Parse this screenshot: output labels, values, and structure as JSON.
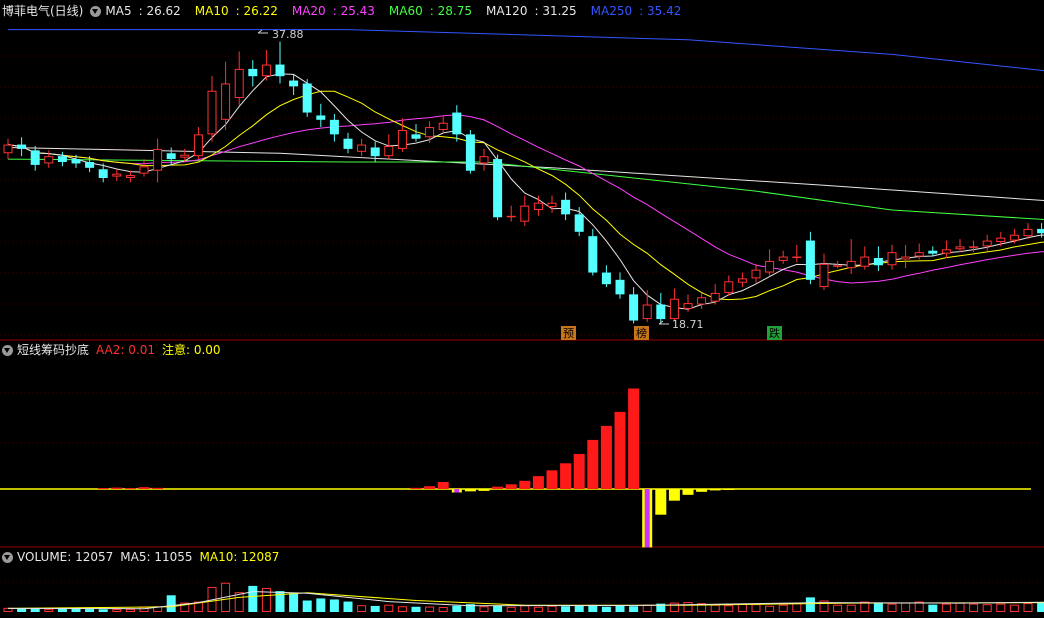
{
  "main_panel": {
    "title": "博菲电气(日线)",
    "ma_labels": [
      {
        "name": "MA5",
        "value": "26.62",
        "color": "#e6e6e6"
      },
      {
        "name": "MA10",
        "value": "26.22",
        "color": "#ffff00"
      },
      {
        "name": "MA20",
        "value": "25.43",
        "color": "#ff40ff"
      },
      {
        "name": "MA60",
        "value": "28.75",
        "color": "#40ff40"
      },
      {
        "name": "MA120",
        "value": "31.25",
        "color": "#e6e6e6"
      },
      {
        "name": "MA250",
        "value": "35.42",
        "color": "#3355ff"
      }
    ],
    "high_marker": "37.88",
    "low_marker": "18.71",
    "event_tags": [
      "预",
      "榜",
      "跌"
    ]
  },
  "indicator_panel": {
    "title": "短线筹码抄底",
    "aa2_label": "AA2: 0.01",
    "note_label": "注意: 0.00"
  },
  "volume_panel": {
    "title": "VOLUME: 12057",
    "ma5_label": "MA5: 11055",
    "ma10_label": "MA10: 12087"
  },
  "chart_data": {
    "type": "candlestick",
    "colors": {
      "up": "#ff3232",
      "down": "#54ffff",
      "background": "#000000",
      "ma5": "#e6e6e6",
      "ma10": "#ffff00",
      "ma20": "#ff40ff",
      "ma60": "#40ff40",
      "ma120": "#e6e6e6",
      "ma250": "#3355ff"
    },
    "price_range": [
      17.5,
      39.5
    ],
    "candles": [
      [
        30.2,
        30.8,
        31.2,
        29.8
      ],
      [
        30.8,
        30.5,
        31.3,
        30.0
      ],
      [
        30.4,
        29.4,
        30.7,
        29.0
      ],
      [
        29.5,
        30.0,
        30.4,
        29.2
      ],
      [
        30.0,
        29.6,
        30.3,
        29.3
      ],
      [
        29.8,
        29.5,
        30.1,
        29.2
      ],
      [
        29.6,
        29.2,
        30.0,
        28.9
      ],
      [
        29.1,
        28.5,
        29.5,
        28.2
      ],
      [
        28.6,
        28.8,
        29.1,
        28.3
      ],
      [
        28.5,
        28.7,
        29.0,
        28.2
      ],
      [
        28.8,
        29.3,
        29.8,
        28.6
      ],
      [
        29.0,
        30.5,
        31.2,
        28.2
      ],
      [
        30.2,
        29.8,
        30.6,
        29.4
      ],
      [
        29.9,
        30.1,
        30.5,
        29.6
      ],
      [
        30.0,
        31.5,
        32.0,
        29.8
      ],
      [
        31.5,
        34.5,
        35.5,
        31.0
      ],
      [
        32.5,
        35.0,
        36.5,
        31.8
      ],
      [
        34.0,
        36.0,
        37.2,
        33.5
      ],
      [
        36.0,
        35.5,
        36.6,
        34.8
      ],
      [
        35.5,
        36.3,
        37.3,
        35.2
      ],
      [
        36.3,
        35.5,
        37.88,
        35.0
      ],
      [
        35.2,
        34.8,
        35.6,
        34.2
      ],
      [
        35.0,
        33.0,
        35.3,
        32.7
      ],
      [
        32.8,
        32.5,
        33.6,
        32.0
      ],
      [
        32.5,
        31.5,
        32.9,
        31.0
      ],
      [
        31.2,
        30.5,
        31.6,
        30.2
      ],
      [
        30.3,
        30.8,
        31.2,
        30.0
      ],
      [
        30.6,
        30.0,
        31.0,
        29.6
      ],
      [
        30.0,
        30.7,
        31.5,
        29.8
      ],
      [
        30.5,
        31.8,
        32.6,
        30.3
      ],
      [
        31.5,
        31.2,
        32.2,
        31.0
      ],
      [
        31.3,
        32.0,
        32.4,
        30.9
      ],
      [
        31.8,
        32.3,
        32.8,
        31.6
      ],
      [
        33.0,
        31.5,
        33.5,
        31.0
      ],
      [
        31.5,
        29.0,
        31.8,
        28.8
      ],
      [
        29.5,
        30.0,
        30.5,
        29.0
      ],
      [
        29.8,
        25.8,
        30.1,
        25.6
      ],
      [
        25.9,
        25.9,
        26.6,
        25.5
      ],
      [
        25.5,
        26.6,
        27.3,
        25.2
      ],
      [
        26.3,
        26.8,
        27.3,
        25.9
      ],
      [
        26.5,
        26.8,
        27.3,
        26.1
      ],
      [
        27.0,
        26.0,
        27.5,
        25.6
      ],
      [
        26.0,
        24.8,
        26.5,
        24.5
      ],
      [
        24.5,
        22.0,
        25.0,
        21.8
      ],
      [
        22.0,
        21.2,
        22.5,
        21.0
      ],
      [
        21.5,
        20.5,
        22.0,
        20.2
      ],
      [
        20.5,
        18.7,
        21.0,
        18.5
      ],
      [
        18.8,
        19.8,
        20.8,
        18.6
      ],
      [
        19.8,
        18.8,
        20.6,
        18.5
      ],
      [
        18.8,
        20.2,
        20.9,
        18.71
      ],
      [
        19.5,
        19.9,
        20.5,
        19.3
      ],
      [
        19.8,
        20.3,
        20.6,
        19.5
      ],
      [
        20.0,
        20.6,
        21.2,
        19.8
      ],
      [
        20.6,
        21.4,
        21.8,
        20.4
      ],
      [
        21.3,
        21.6,
        22.0,
        21.0
      ],
      [
        21.6,
        22.2,
        22.6,
        21.3
      ],
      [
        22.0,
        22.8,
        23.6,
        21.8
      ],
      [
        22.8,
        23.1,
        23.5,
        22.6
      ],
      [
        23.0,
        23.1,
        23.9,
        22.7
      ],
      [
        24.2,
        21.5,
        24.8,
        21.2
      ],
      [
        21.0,
        22.6,
        23.3,
        20.8
      ],
      [
        22.5,
        22.5,
        22.8,
        22.3
      ],
      [
        22.3,
        22.8,
        24.3,
        21.9
      ],
      [
        22.4,
        23.1,
        23.8,
        22.2
      ],
      [
        23.0,
        22.5,
        23.8,
        22.1
      ],
      [
        22.5,
        23.4,
        23.9,
        22.2
      ],
      [
        22.9,
        23.1,
        23.9,
        22.3
      ],
      [
        23.1,
        23.4,
        24.0,
        22.9
      ],
      [
        23.5,
        23.3,
        23.8,
        23.1
      ],
      [
        23.3,
        23.6,
        24.2,
        23.0
      ],
      [
        23.6,
        23.8,
        24.3,
        23.4
      ],
      [
        23.8,
        23.8,
        24.2,
        23.4
      ],
      [
        23.8,
        24.2,
        24.6,
        23.5
      ],
      [
        24.1,
        24.4,
        24.8,
        23.8
      ],
      [
        24.2,
        24.6,
        25.0,
        24.0
      ],
      [
        24.5,
        25.0,
        25.4,
        24.3
      ],
      [
        25.0,
        24.7,
        25.4,
        24.4
      ],
      [
        25.0,
        23.9,
        25.2,
        23.7
      ]
    ],
    "ma_series": {
      "ma120_points": [
        [
          0,
          30.6
        ],
        [
          20,
          30.2
        ],
        [
          40,
          29.2
        ],
        [
          60,
          28.0
        ],
        [
          77,
          26.9
        ]
      ],
      "ma250_points": [
        [
          0,
          38.7
        ],
        [
          25,
          38.7
        ],
        [
          50,
          38.0
        ],
        [
          65,
          37.0
        ],
        [
          77,
          35.8
        ]
      ],
      "ma60_points": [
        [
          0,
          29.8
        ],
        [
          25,
          29.6
        ],
        [
          35,
          29.6
        ],
        [
          45,
          28.6
        ],
        [
          55,
          27.6
        ],
        [
          65,
          26.3
        ],
        [
          77,
          25.6
        ]
      ]
    },
    "indicator": {
      "range": [
        -2.5,
        5.5
      ],
      "bars": [
        [
          7,
          0.04,
          "red"
        ],
        [
          8,
          0.06,
          "red"
        ],
        [
          9,
          0.04,
          "red"
        ],
        [
          10,
          0.08,
          "red"
        ],
        [
          11,
          0.05,
          "red"
        ],
        [
          30,
          0.05,
          "red"
        ],
        [
          31,
          0.12,
          "red"
        ],
        [
          32,
          0.3,
          "red"
        ],
        [
          33,
          -0.15,
          "magenta"
        ],
        [
          34,
          -0.1,
          "yellow"
        ],
        [
          35,
          -0.08,
          "yellow"
        ],
        [
          36,
          0.1,
          "red"
        ],
        [
          37,
          0.2,
          "red"
        ],
        [
          38,
          0.35,
          "red"
        ],
        [
          39,
          0.55,
          "red"
        ],
        [
          40,
          0.8,
          "red"
        ],
        [
          41,
          1.1,
          "red"
        ],
        [
          42,
          1.5,
          "red"
        ],
        [
          43,
          2.1,
          "red"
        ],
        [
          44,
          2.7,
          "red"
        ],
        [
          45,
          3.3,
          "red"
        ],
        [
          46,
          4.3,
          "red"
        ],
        [
          47,
          -2.5,
          "magenta"
        ],
        [
          48,
          -1.1,
          "yellow"
        ],
        [
          49,
          -0.5,
          "yellow"
        ],
        [
          50,
          -0.25,
          "yellow"
        ],
        [
          51,
          -0.12,
          "yellow"
        ],
        [
          52,
          -0.06,
          "yellow"
        ],
        [
          53,
          -0.03,
          "yellow"
        ]
      ]
    },
    "volume": {
      "max": 45000,
      "values": [
        4000,
        3500,
        3200,
        3000,
        3000,
        2900,
        2800,
        2600,
        2800,
        3000,
        5000,
        5500,
        16000,
        9000,
        10000,
        24000,
        28000,
        19000,
        25000,
        23000,
        20000,
        18000,
        11000,
        13000,
        12000,
        10000,
        6500,
        5800,
        7000,
        5500,
        5000,
        5200,
        4800,
        6000,
        7500,
        5500,
        6000,
        5000,
        6500,
        5000,
        6000,
        5500,
        6500,
        6800,
        5000,
        6000,
        5500,
        7000,
        8000,
        9000,
        9500,
        8500,
        7000,
        6500,
        8000,
        7500,
        6000,
        7000,
        8500,
        14000,
        11000,
        7000,
        7000,
        10000,
        9000,
        8000,
        9000,
        10000,
        7000,
        8000,
        9000,
        8000,
        7500,
        8000,
        7000,
        8500,
        9000,
        12057
      ],
      "ma5_points": [
        [
          0,
          3400
        ],
        [
          10,
          3200
        ],
        [
          14,
          9000
        ],
        [
          18,
          19500
        ],
        [
          22,
          18000
        ],
        [
          28,
          10000
        ],
        [
          34,
          6000
        ],
        [
          46,
          6200
        ],
        [
          60,
          9000
        ],
        [
          70,
          8500
        ],
        [
          77,
          9500
        ]
      ],
      "ma10_points": [
        [
          0,
          3400
        ],
        [
          12,
          5000
        ],
        [
          17,
          14000
        ],
        [
          22,
          18500
        ],
        [
          30,
          11000
        ],
        [
          38,
          6500
        ],
        [
          50,
          6500
        ],
        [
          62,
          8500
        ],
        [
          77,
          9000
        ]
      ]
    }
  }
}
